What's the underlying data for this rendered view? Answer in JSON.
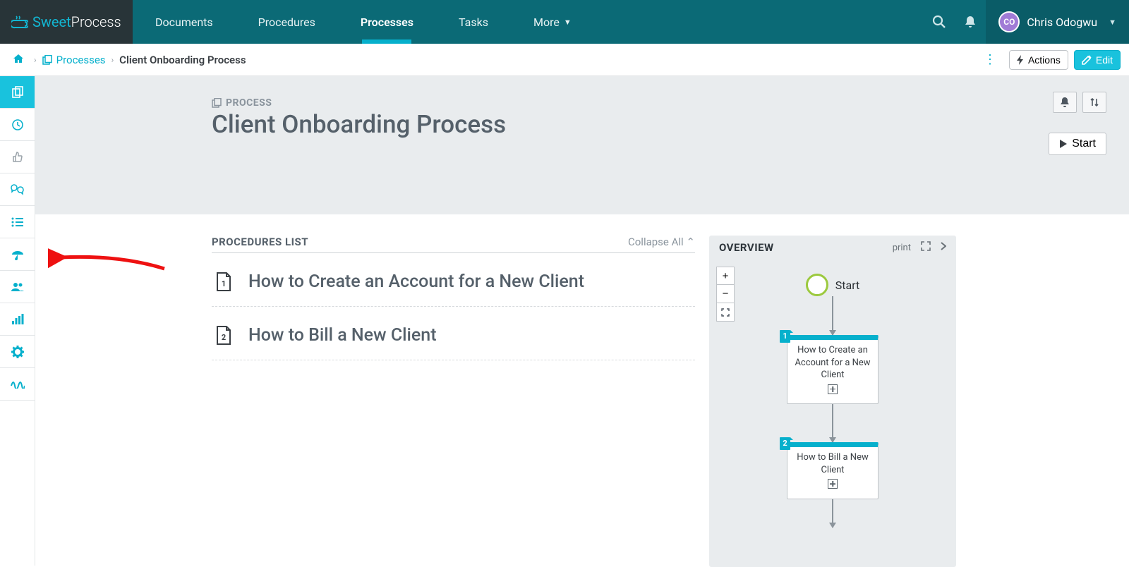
{
  "brand": {
    "sweet": "Sweet",
    "process": "Process"
  },
  "nav": {
    "documents": "Documents",
    "procedures": "Procedures",
    "processes": "Processes",
    "tasks": "Tasks",
    "more": "More"
  },
  "user": {
    "initials": "CO",
    "name": "Chris Odogwu"
  },
  "breadcrumb": {
    "processes": "Processes",
    "current": "Client Onboarding Process"
  },
  "actions": {
    "actions": "Actions",
    "edit": "Edit"
  },
  "hero": {
    "label": "PROCESS",
    "title": "Client Onboarding Process",
    "start": "Start"
  },
  "list": {
    "heading": "PROCEDURES LIST",
    "collapse": "Collapse All",
    "items": [
      {
        "num": "1",
        "title": "How to Create an Account for a New Client"
      },
      {
        "num": "2",
        "title": "How to Bill a New Client"
      }
    ]
  },
  "overview": {
    "heading": "OVERVIEW",
    "print": "print",
    "start": "Start",
    "cards": [
      {
        "num": "1",
        "title": "How to Create an Account for a New Client"
      },
      {
        "num": "2",
        "title": "How to Bill a New Client"
      }
    ]
  }
}
